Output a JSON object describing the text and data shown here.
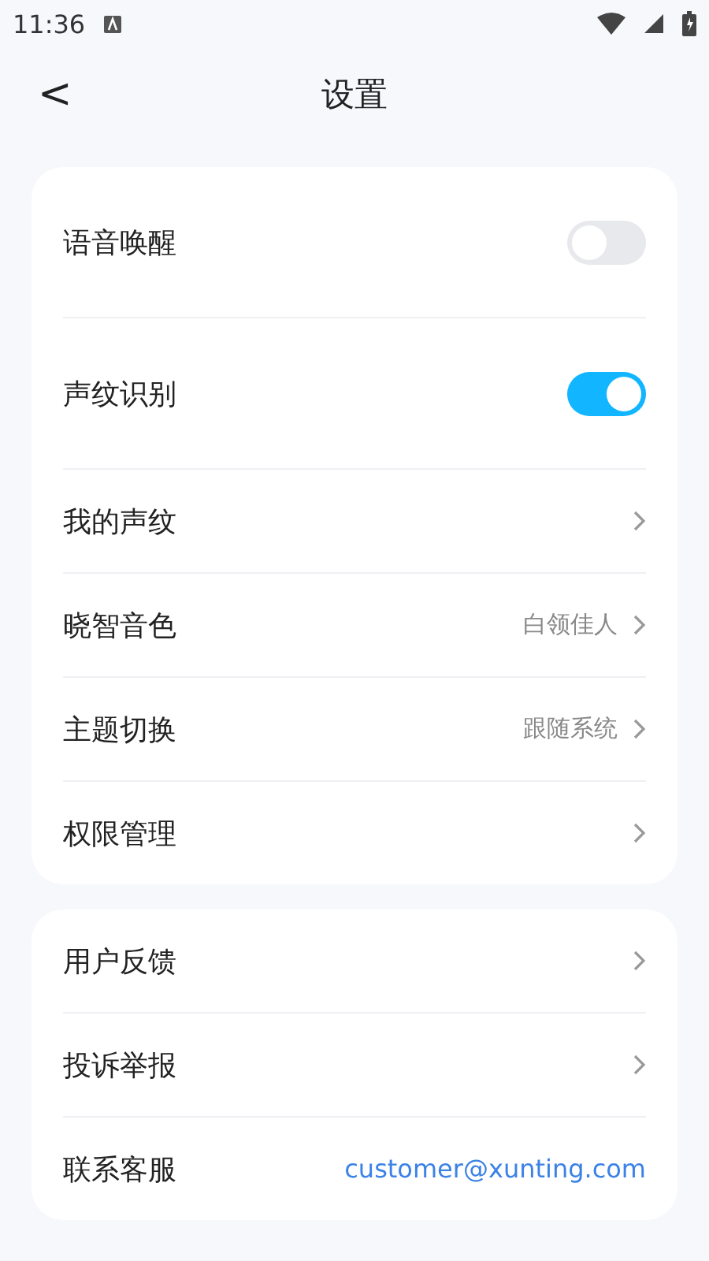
{
  "status_bar": {
    "time": "11:36"
  },
  "header": {
    "back": "<",
    "title": "设置"
  },
  "groups": [
    {
      "rows": [
        {
          "kind": "toggle",
          "label": "语音唤醒",
          "on": false
        },
        {
          "kind": "toggle",
          "label": "声纹识别",
          "on": true
        },
        {
          "kind": "link",
          "label": "我的声纹"
        },
        {
          "kind": "link",
          "label": "晓智音色",
          "value": "白领佳人"
        },
        {
          "kind": "link",
          "label": "主题切换",
          "value": "跟随系统"
        },
        {
          "kind": "link",
          "label": "权限管理"
        }
      ]
    },
    {
      "rows": [
        {
          "kind": "link",
          "label": "用户反馈"
        },
        {
          "kind": "link",
          "label": "投诉举报"
        },
        {
          "kind": "email",
          "label": "联系客服",
          "value": "customer@xunting.com"
        }
      ]
    }
  ]
}
